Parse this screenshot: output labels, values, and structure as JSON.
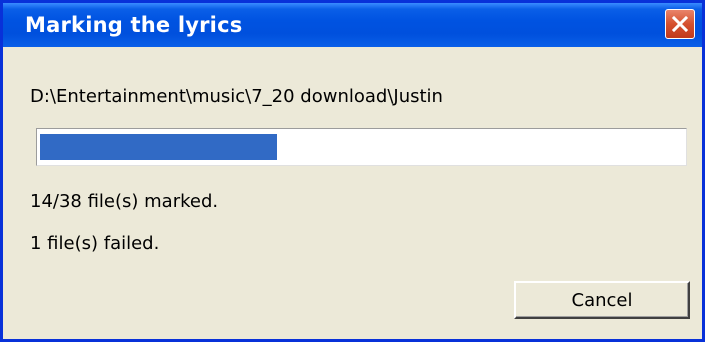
{
  "window": {
    "title": "Marking the lyrics",
    "close_icon": "close-icon"
  },
  "content": {
    "path": "D:\\Entertainment\\music\\7_20 download\\Justin",
    "progress_fraction": 0.3684,
    "marked_status": "14/38 file(s) marked.",
    "failed_status": "1 file(s) failed."
  },
  "buttons": {
    "cancel_label": "Cancel"
  },
  "colors": {
    "titlebar": "#0053e1",
    "progress_fill": "#316ac5",
    "close_button": "#d5512f",
    "dialog_background": "#ece9d8"
  }
}
